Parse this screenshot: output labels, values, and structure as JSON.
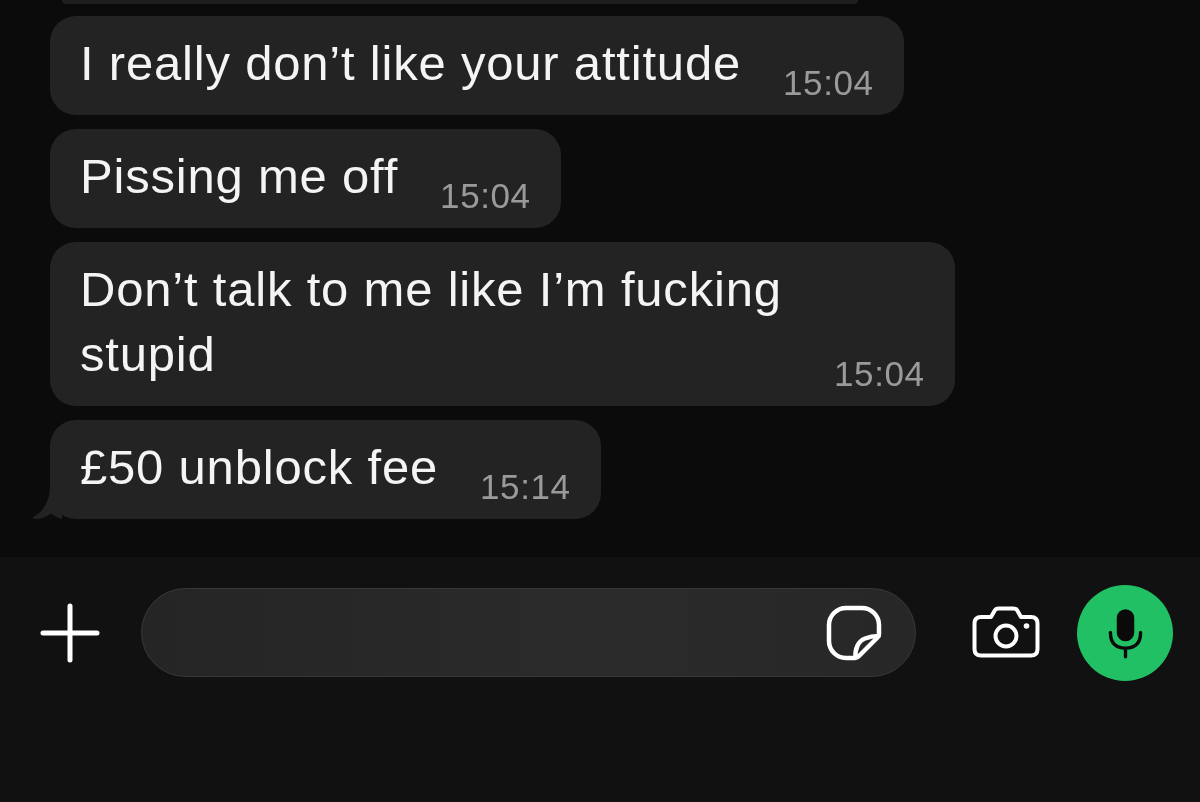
{
  "messages": [
    {
      "text": "I really don’t like your attitude",
      "time": "15:04",
      "tail": false
    },
    {
      "text": "Pissing me off",
      "time": "15:04",
      "tail": false
    },
    {
      "text": "Don’t talk to me like I’m fucking stupid",
      "time": "15:04",
      "tail": false
    },
    {
      "text": "£50 unblock fee",
      "time": "15:14",
      "tail": true
    }
  ]
}
